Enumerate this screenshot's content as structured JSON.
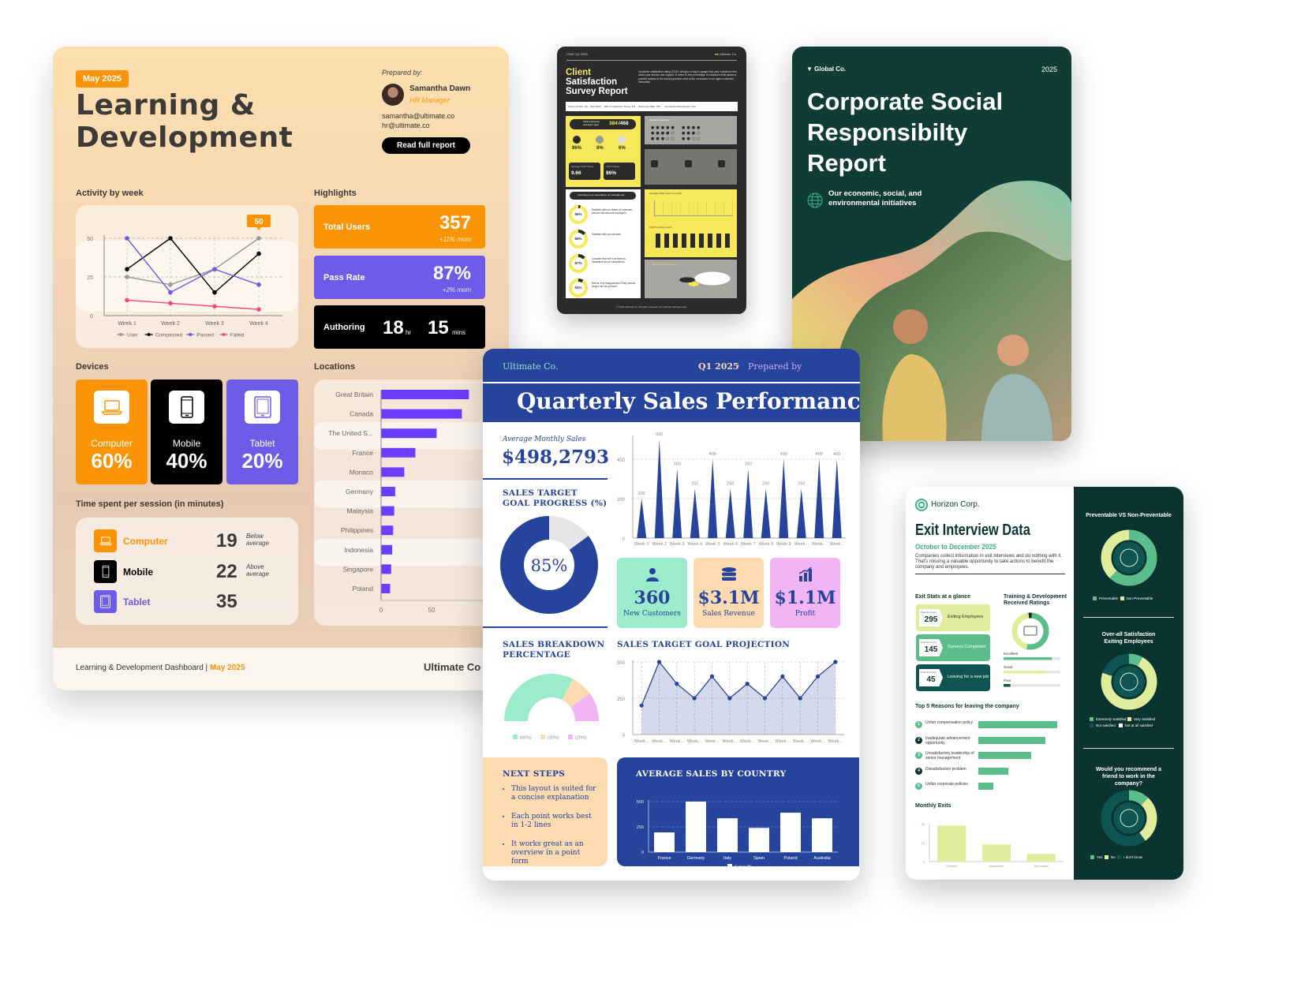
{
  "learning_dev": {
    "badge": "May 2025",
    "title_line1": "Learning &",
    "title_line2": "Development",
    "prepared_label": "Prepared by:",
    "author_name": "Samantha Dawn",
    "author_role": "HR Manager",
    "emails": [
      "samantha@ultimate.co",
      "hr@ultimate.co"
    ],
    "read_button": "Read full report",
    "activity_title": "Activity by week",
    "highlights_title": "Highlights",
    "devices_title": "Devices",
    "locations_title": "Locations",
    "time_title": "Time spent per session (in minutes)",
    "tooltip_value": "50",
    "highlights": [
      {
        "label": "Total Users",
        "value": "357",
        "sub": "+11% mom",
        "color": "#fb9405"
      },
      {
        "label": "Pass Rate",
        "value": "87%",
        "sub": "+2% mom",
        "color": "#6c5ce7"
      }
    ],
    "authoring": {
      "label": "Authoring",
      "hours": "18",
      "hours_unit": "hr",
      "mins": "15",
      "mins_unit": "mins"
    },
    "devices": [
      {
        "label": "Computer",
        "value": "60%",
        "color": "#fb9405",
        "icon": "laptop-icon"
      },
      {
        "label": "Mobile",
        "value": "40%",
        "color": "#000000",
        "icon": "mobile-icon"
      },
      {
        "label": "Tablet",
        "value": "20%",
        "color": "#6c5ce7",
        "icon": "tablet-icon"
      }
    ],
    "time_spent": [
      {
        "label": "Computer",
        "value": "19",
        "comment_1": "Below",
        "comment_2": "average",
        "color": "#fb9405"
      },
      {
        "label": "Mobile",
        "value": "22",
        "comment_1": "Above",
        "comment_2": "average",
        "color": "#000000"
      },
      {
        "label": "Tablet",
        "value": "35",
        "comment_1": "",
        "comment_2": "",
        "color": "#6c5ce7"
      }
    ],
    "footer_text": "Learning & Development Dashboard |",
    "footer_date": "May 2025",
    "footer_brand": "Ultimate Co"
  },
  "chart_data": [
    {
      "type": "line",
      "title": "Activity by week",
      "categories": [
        "Week 1",
        "Week 2",
        "Week 3",
        "Week 4"
      ],
      "ylim": [
        0,
        50
      ],
      "yticks": [
        0,
        25,
        50
      ],
      "grid": true,
      "legend": "bottom",
      "series": [
        {
          "name": "User",
          "color": "#999999",
          "values": [
            25,
            20,
            30,
            50
          ]
        },
        {
          "name": "Compassed",
          "color": "#000000",
          "values": [
            30,
            50,
            15,
            40
          ]
        },
        {
          "name": "Passed",
          "color": "#6c5ce7",
          "values": [
            50,
            15,
            30,
            20
          ]
        },
        {
          "name": "Failed",
          "color": "#f5487f",
          "values": [
            10,
            8,
            6,
            4
          ]
        }
      ]
    },
    {
      "type": "bar",
      "orientation": "horizontal",
      "title": "Locations",
      "categories": [
        "Great Britain",
        "Canada",
        "The United S...",
        "France",
        "Monaco",
        "Germany",
        "Malaysia",
        "Philippines",
        "Indonesia",
        "Singapore",
        "Poland"
      ],
      "values": [
        87,
        80,
        55,
        34,
        23,
        14,
        13,
        12,
        11,
        10,
        9
      ],
      "xticks": [
        0,
        50
      ],
      "xlim": [
        0,
        90
      ],
      "color": "#6b3dfc"
    },
    {
      "type": "bar",
      "title": "Weekly Sales",
      "categories": [
        "Week 1",
        "Week 2",
        "Week 3",
        "Week 4",
        "Week 5",
        "Week 6",
        "Week 7",
        "Week 8",
        "Week 9",
        "Week...",
        "Week...",
        "Week..."
      ],
      "values": [
        200,
        500,
        350,
        250,
        400,
        250,
        350,
        250,
        400,
        250,
        400,
        400
      ],
      "ylim": [
        0,
        500
      ],
      "yticks": [
        0,
        200,
        400
      ],
      "color": "#27449c"
    },
    {
      "type": "pie",
      "title": "Sales Breakdown Percentage",
      "labels": [
        "(65%)",
        "(15%)",
        "(20%)"
      ],
      "values": [
        65,
        15,
        20
      ],
      "colors": [
        "#9cebcc",
        "#fddbb1",
        "#f1b5f5"
      ]
    },
    {
      "type": "area",
      "title": "Sales Target Goal Projection",
      "categories": [
        "Week...",
        "Week...",
        "Week...",
        "Week...",
        "Week...",
        "Week...",
        "Week...",
        "Week...",
        "Week...",
        "Week...",
        "Week...",
        "Week..."
      ],
      "values": [
        200,
        500,
        350,
        250,
        400,
        250,
        350,
        250,
        400,
        250,
        400,
        500
      ],
      "ylim": [
        0,
        500
      ],
      "yticks": [
        0,
        250,
        500
      ],
      "grid": true,
      "color": "#27449c"
    },
    {
      "type": "bar",
      "title": "Average Sales by Country",
      "categories": [
        "France",
        "Germany",
        "Italy",
        "Spain",
        "Poland",
        "Australia"
      ],
      "values": [
        195,
        500,
        335,
        240,
        390,
        335
      ],
      "ylim": [
        0,
        500
      ],
      "yticks": [
        0,
        250,
        500
      ],
      "legend": "bottom",
      "series_name": "Sales ($)",
      "color": "#ffffff"
    }
  ],
  "csat": {
    "tag": "CSAT Q3 2025",
    "brand": "Ultimate Co.",
    "title_1": "Client",
    "title_2": "Satisfaction",
    "title_3": "Survey Report",
    "intro": "Customer satisfaction rating (CSAT rating) is a way to gauge how your customers feel about your service and support. It refers to the percentage of customers that picked a positive answer to the survey question sent at the conclusion of an agent-customer interaction.",
    "meta": [
      "Survey Period: Jan - Sept 2025",
      "Way of Collection: Survey link",
      "Response Rate: 75%",
      "Companies Represented: 210"
    ],
    "responses_label": "Total responses received / goal",
    "responses": "384",
    "goal": "/468",
    "moods": [
      {
        "value": "86%",
        "label": "Great"
      },
      {
        "value": "8%",
        "label": "Neutral"
      },
      {
        "value": "6%",
        "label": "Bad"
      }
    ],
    "avg_score_label": "Average CSAT Score",
    "avg_score": "9.66",
    "avg_delta": "0.35",
    "rating_label": "CSAT Rating",
    "rating": "86%",
    "results_label": "Results breakdown",
    "strengths_label": "According to our respondents, our strengths are:",
    "strengths": [
      {
        "value": "96%",
        "text": "Satisfied with our teams of customer service and account managers."
      },
      {
        "value": "86%",
        "text": "Satisfied with our services."
      },
      {
        "value": "87%",
        "text": "Consider that we're at least as innovative as our competitors."
      },
      {
        "value": "91%",
        "text": "Will be very disappointed if they cannot longer use our product."
      }
    ],
    "badges": [
      "Confidence in the result",
      "Credible sources",
      "Timely updates"
    ],
    "avg_month_label": "Average CSAT score by month",
    "trend_label": "CSAT trend by month",
    "region_label": "CSAT score by regions",
    "months": [
      "Jan",
      "Feb",
      "March",
      "Apr",
      "May",
      "Jun",
      "Jul",
      "Aug",
      "Sep"
    ],
    "footer": "© 2025 Ultimate Co. All rights reserved. For internal purposes only."
  },
  "csr": {
    "brand": "Global Co.",
    "year": "2025",
    "title_1": "Corporate Social",
    "title_2": "Responsibilty",
    "title_3": "Report",
    "subtitle": "Our economic, social, and environmental initiatives"
  },
  "sales": {
    "company": "Ultimate Co.",
    "quarter": "Q1 2025",
    "dot": "·",
    "prepared": "Prepared by",
    "title": "Quarterly Sales Performance",
    "avg_label": "Average Monthly Sales",
    "avg_value": "$498,2793",
    "goal_title_1": "SALES TARGET",
    "goal_title_2": "GOAL PROGRESS (%)",
    "goal_progress": 85,
    "goal_progress_label": "85%",
    "tiles": [
      {
        "value": "360",
        "label": "New Customers",
        "color": "#9cebcc",
        "icon": "user-icon"
      },
      {
        "value": "$3.1M",
        "label": "Sales Revenue",
        "color": "#fddbb1",
        "icon": "database-icon"
      },
      {
        "value": "$1.1M",
        "label": "Profit",
        "color": "#f1b5f5",
        "icon": "bar-chart-icon"
      }
    ],
    "breakdown_title_1": "SALES BREAKDOWN",
    "breakdown_title_2": "PERCENTAGE",
    "projection_title": "SALES TARGET GOAL PROJECTION",
    "next_steps_title": "NEXT STEPS",
    "next_steps": [
      "This layout is suited for a concise explanation",
      "Each point works best in 1-2 lines",
      "It works great as an overview in a point form"
    ],
    "country_title": "AVERAGE SALES BY COUNTRY"
  },
  "exit": {
    "brand": "Horizon Corp.",
    "title": "Exit Interview Data",
    "period": "October to December 2025",
    "intro": "Companies collect information in exit interviews and do nothing with it. That's missing a valuable opportunity to take actions to benefit the company and employees.",
    "stats_title": "Exit Stats at a glance",
    "stat_caption": "Data Summary",
    "stats": [
      {
        "value": "295",
        "label": "Exiting Employees",
        "color": "#e0eb9c",
        "text": "#333333"
      },
      {
        "value": "145",
        "label": "Surveys Completed",
        "color": "#5bbd8a",
        "text": "#ffffff"
      },
      {
        "value": "45",
        "label": "Leaving for a new job",
        "color": "#0e5552",
        "text": "#ffffff"
      }
    ],
    "training_title": "Training & Development Received Ratings",
    "ratings": [
      {
        "label": "Excellent",
        "value": 0.85,
        "color": "#5bbd8a"
      },
      {
        "label": "Good",
        "value": 0.75,
        "color": "#e0eb9c"
      },
      {
        "label": "Poor",
        "value": 0.12,
        "color": "#0e5552"
      }
    ],
    "reasons_title": "Top 5 Reasons for leaving the company",
    "reasons": [
      {
        "n": "1",
        "text": "Unfair compensation policy",
        "value": 1.0
      },
      {
        "n": "2",
        "text": "Inadequate advancement opportunity",
        "value": 0.85
      },
      {
        "n": "3",
        "text": "Unsatisfactory leadership of senior management",
        "value": 0.67
      },
      {
        "n": "4",
        "text": "Dissatisfaction problem",
        "value": 0.38
      },
      {
        "n": "5",
        "text": "Unfair corporate policies",
        "value": 0.19
      }
    ],
    "monthly_title": "Monthly Exits",
    "monthly": {
      "categories": [
        "October",
        "November",
        "December"
      ],
      "values": [
        19,
        9,
        4
      ],
      "yticks": [
        0,
        10,
        20
      ]
    },
    "preventable_title": "Preventable VS Non-Preventable",
    "preventable_legend": [
      "Preventable",
      "Non-Preventable"
    ],
    "satisfaction_title": "Over-all Satisfaction Exiting Employees",
    "satisfaction_legend": [
      "Extremely Satisfied",
      "Very Satisfied",
      "Not satisfied",
      "Not at all satisfied"
    ],
    "recommend_title": "Would you recommend a friend to work in the company?",
    "recommend_legend": [
      "Yes",
      "No",
      "I don't know"
    ]
  }
}
